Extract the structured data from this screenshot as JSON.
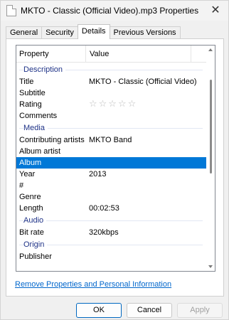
{
  "window": {
    "title": "MKTO - Classic (Official Video).mp3 Properties"
  },
  "tabs": [
    {
      "label": "General",
      "active": false
    },
    {
      "label": "Security",
      "active": false
    },
    {
      "label": "Details",
      "active": true
    },
    {
      "label": "Previous Versions",
      "active": false
    }
  ],
  "list": {
    "header_property": "Property",
    "header_value": "Value",
    "groups": [
      {
        "name": "Description",
        "rows": [
          {
            "prop": "Title",
            "val": "MKTO - Classic (Official Video)"
          },
          {
            "prop": "Subtitle",
            "val": ""
          },
          {
            "prop": "Rating",
            "val": "☆☆☆☆☆",
            "rating": 0,
            "max": 5
          },
          {
            "prop": "Comments",
            "val": ""
          }
        ]
      },
      {
        "name": "Media",
        "rows": [
          {
            "prop": "Contributing artists",
            "val": "MKTO Band"
          },
          {
            "prop": "Album artist",
            "val": ""
          },
          {
            "prop": "Album",
            "val": "",
            "selected": true
          },
          {
            "prop": "Year",
            "val": "2013"
          },
          {
            "prop": "#",
            "val": ""
          },
          {
            "prop": "Genre",
            "val": ""
          },
          {
            "prop": "Length",
            "val": "00:02:53"
          }
        ]
      },
      {
        "name": "Audio",
        "rows": [
          {
            "prop": "Bit rate",
            "val": "320kbps"
          }
        ]
      },
      {
        "name": "Origin",
        "rows": [
          {
            "prop": "Publisher",
            "val": ""
          }
        ]
      }
    ]
  },
  "remove_link": "Remove Properties and Personal Information",
  "buttons": {
    "ok": "OK",
    "cancel": "Cancel",
    "apply": "Apply"
  },
  "colors": {
    "selection": "#0078d7",
    "group_header": "#1e3287",
    "link": "#0066cc"
  },
  "icons": {
    "title_icon": "file-icon",
    "close": "close-icon"
  }
}
